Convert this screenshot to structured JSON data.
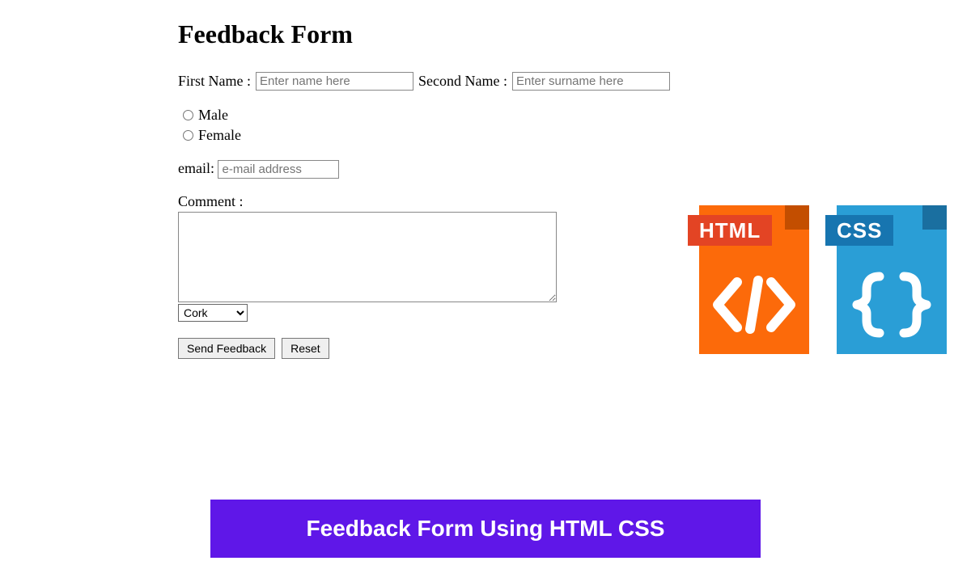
{
  "title": "Feedback Form",
  "firstName": {
    "label": "First Name :",
    "placeholder": "Enter name here"
  },
  "secondName": {
    "label": "Second Name :",
    "placeholder": "Enter surname here"
  },
  "gender": {
    "male": "Male",
    "female": "Female"
  },
  "email": {
    "label": "email:",
    "placeholder": "e-mail address"
  },
  "comment": {
    "label": "Comment :"
  },
  "city": {
    "selected": "Cork"
  },
  "buttons": {
    "send": "Send Feedback",
    "reset": "Reset"
  },
  "icons": {
    "html": "HTML",
    "css": "CSS"
  },
  "banner": "Feedback Form Using HTML CSS"
}
